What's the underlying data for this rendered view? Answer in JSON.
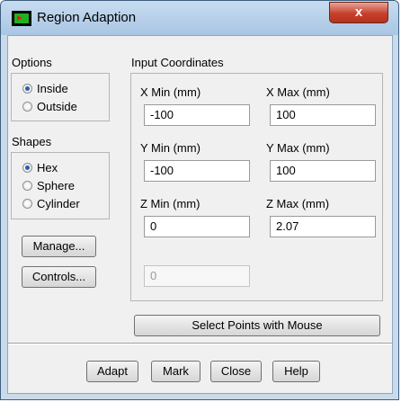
{
  "window": {
    "title": "Region Adaption",
    "close_glyph": "x"
  },
  "options": {
    "title": "Options",
    "items": [
      {
        "label": "Inside",
        "checked": true
      },
      {
        "label": "Outside",
        "checked": false
      }
    ]
  },
  "shapes": {
    "title": "Shapes",
    "items": [
      {
        "label": "Hex",
        "checked": true
      },
      {
        "label": "Sphere",
        "checked": false
      },
      {
        "label": "Cylinder",
        "checked": false
      }
    ]
  },
  "side_buttons": {
    "manage": "Manage...",
    "controls": "Controls..."
  },
  "input_coordinates": {
    "title": "Input Coordinates",
    "x_min": {
      "label": "X Min (mm)",
      "value": "-100"
    },
    "x_max": {
      "label": "X Max (mm)",
      "value": "100"
    },
    "y_min": {
      "label": "Y Min (mm)",
      "value": "-100"
    },
    "y_max": {
      "label": "Y Max (mm)",
      "value": "100"
    },
    "z_min": {
      "label": "Z Min (mm)",
      "value": "0"
    },
    "z_max": {
      "label": "Z Max (mm)",
      "value": "2.07"
    },
    "radius": {
      "value": "0"
    }
  },
  "select_points_button": "Select Points with Mouse",
  "footer": {
    "adapt": "Adapt",
    "mark": "Mark",
    "close": "Close",
    "help": "Help"
  }
}
